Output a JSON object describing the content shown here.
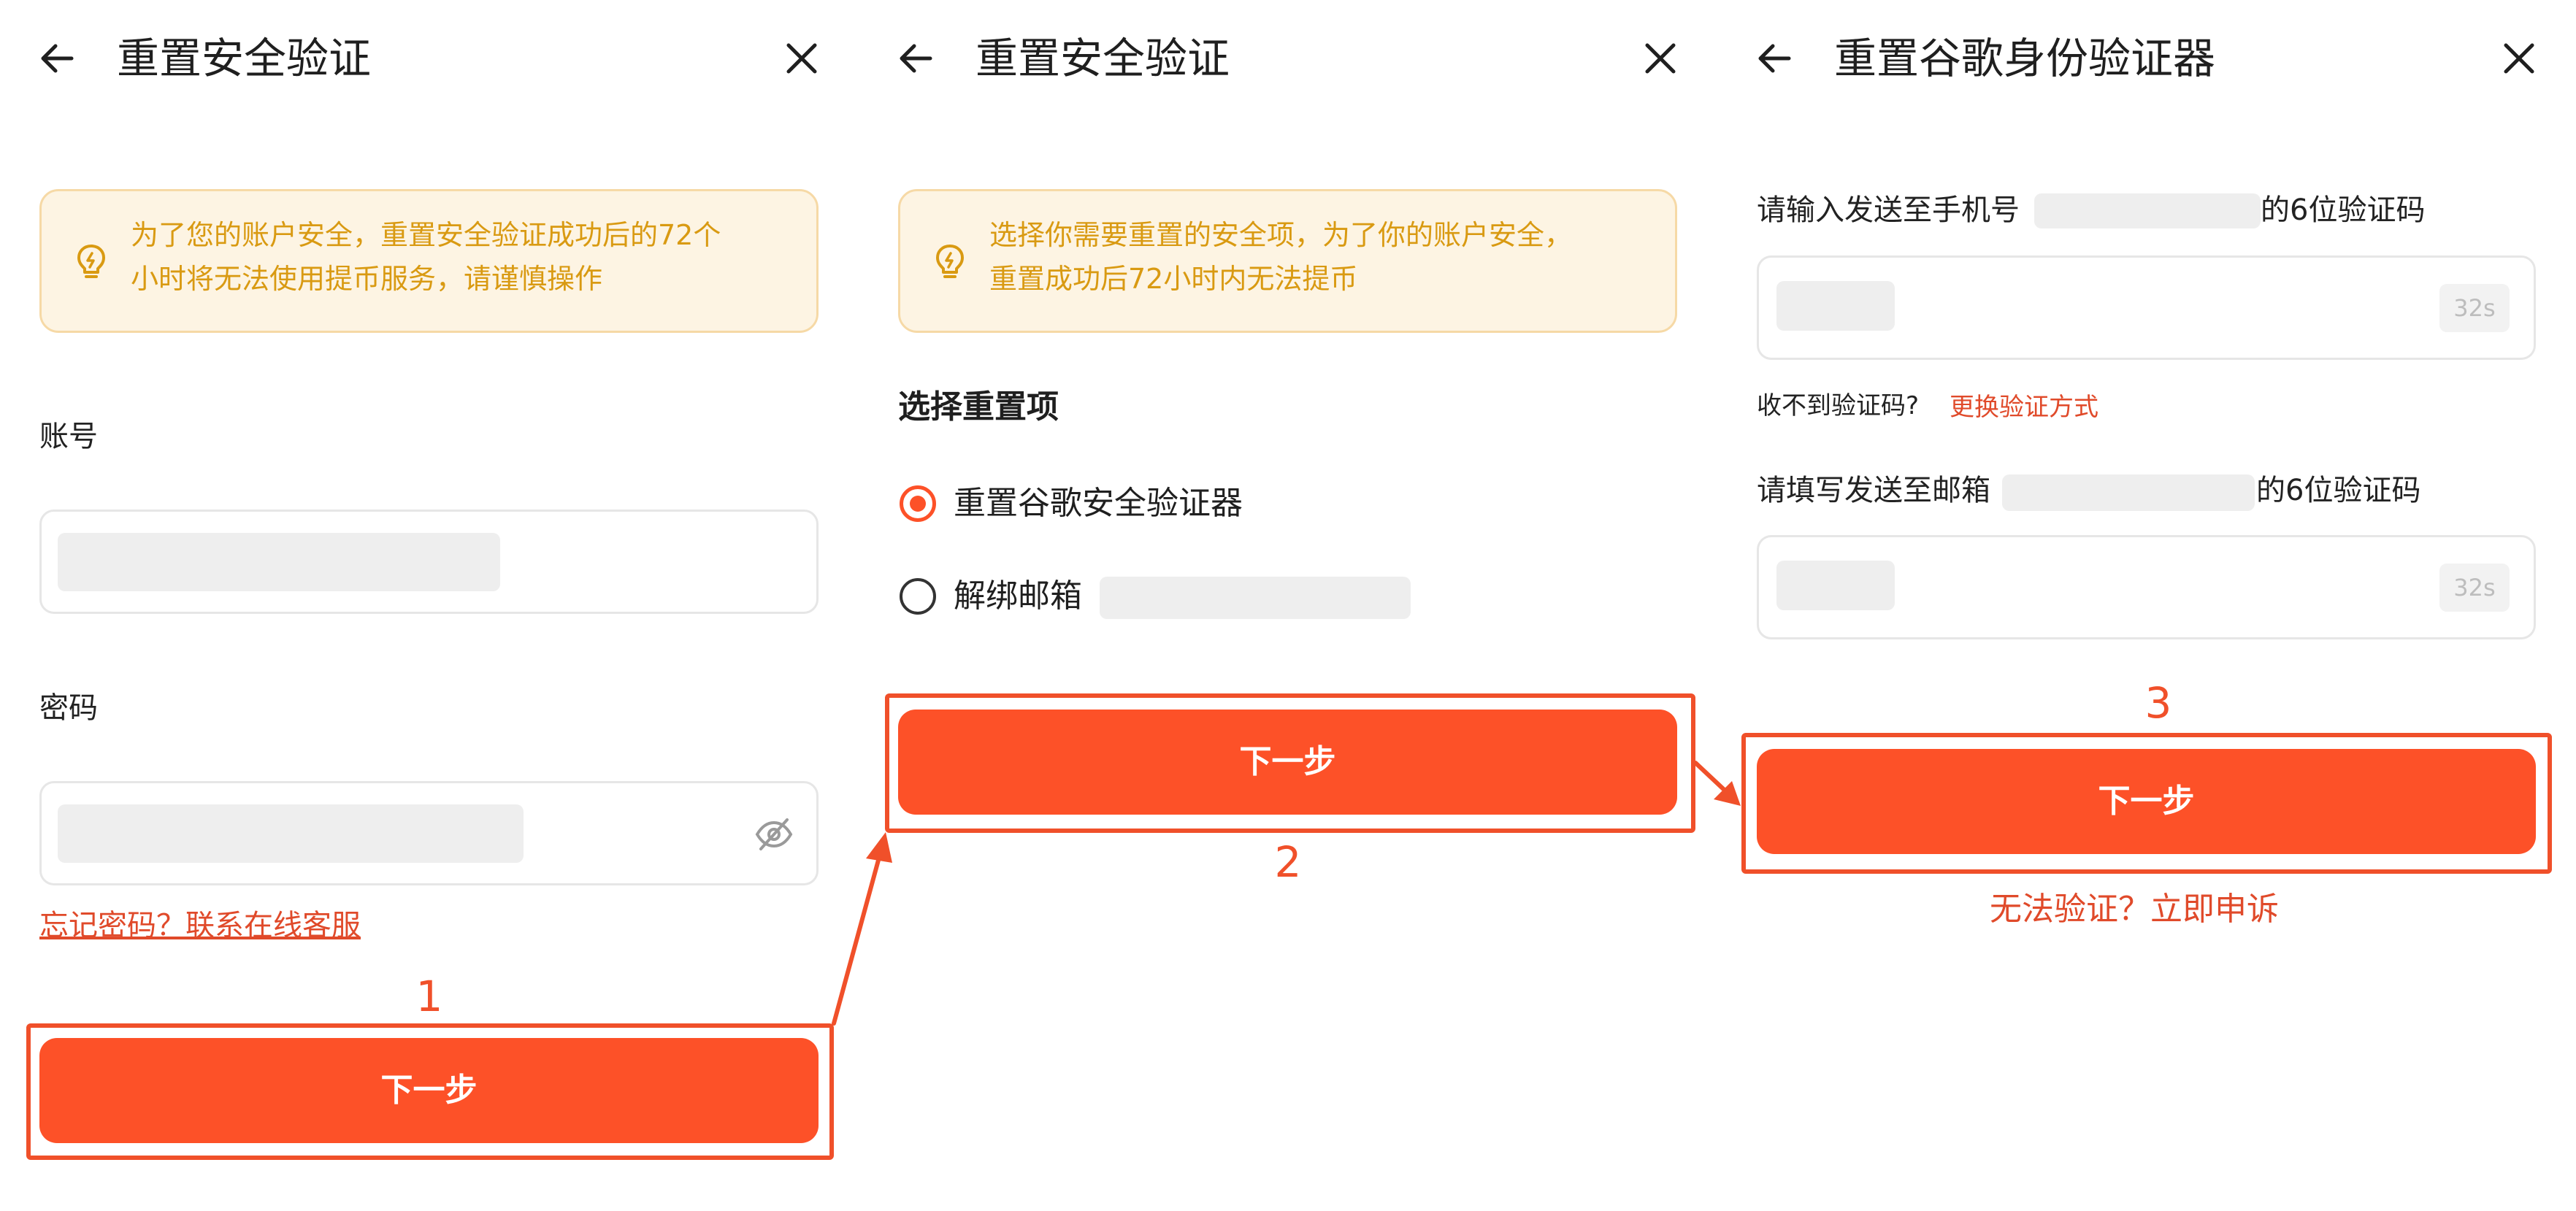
{
  "screens": [
    {
      "title": "重置安全验证",
      "notice": [
        "为了您的账户安全，重置安全验证成功后的72个",
        "小时将无法使用提币服务，请谨慎操作"
      ],
      "account_label": "账号",
      "password_label": "密码",
      "forgot_link": "忘记密码？联系在线客服",
      "step_number": "1",
      "next_button": "下一步"
    },
    {
      "title": "重置安全验证",
      "notice": [
        "选择你需要重置的安全项，为了你的账户安全，",
        "重置成功后72小时内无法提币"
      ],
      "section_title": "选择重置项",
      "options": [
        {
          "label": "重置谷歌安全验证器",
          "selected": true
        },
        {
          "label": "解绑邮箱",
          "selected": false
        }
      ],
      "step_number": "2",
      "next_button": "下一步"
    },
    {
      "title": "重置谷歌身份验证器",
      "phone_prompt_prefix": "请输入发送至手机号",
      "phone_prompt_suffix": "的6位验证码",
      "phone_countdown": "32s",
      "no_code_text": "收不到验证码?",
      "switch_method_link": "更换验证方式",
      "email_prompt_prefix": "请填写发送至邮箱",
      "email_prompt_suffix": "的6位验证码",
      "email_countdown": "32s",
      "step_number": "3",
      "next_button": "下一步",
      "appeal_link": "无法验证？立即申诉"
    }
  ],
  "colors": {
    "accent": "#fd5128",
    "annotation": "#f0502a",
    "notice_bg": "#fdf4e3",
    "notice_text": "#d99a12",
    "link": "#e04a2a"
  },
  "icons": {
    "back": "arrow-left-icon",
    "close": "close-icon",
    "notice": "lightbulb-icon",
    "password_toggle": "eye-off-icon"
  }
}
